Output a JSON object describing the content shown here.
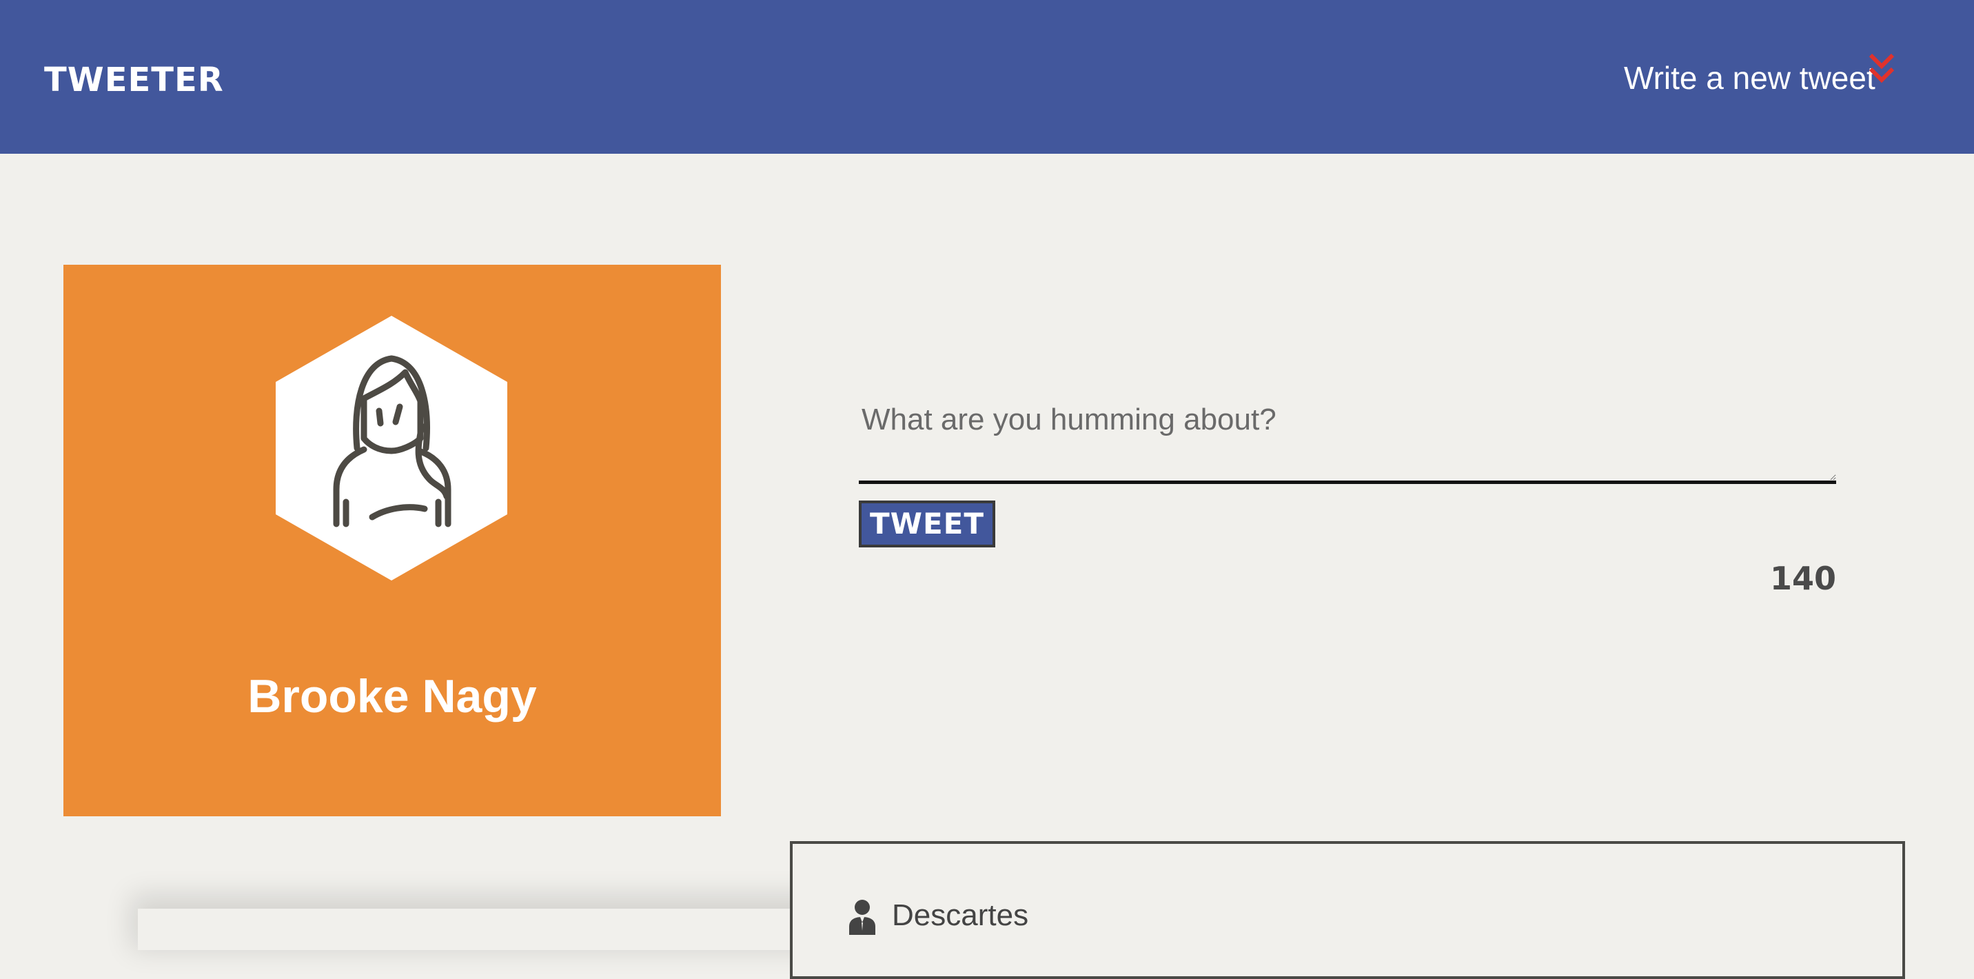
{
  "header": {
    "brand": "TWEETER",
    "compose_link": "Write a new tweet",
    "compose_icon": "double-chevron-down-icon",
    "compose_icon_color": "#e0322c",
    "background_color": "#42579c"
  },
  "profile": {
    "name": "Brooke Nagy",
    "avatar_icon": "woman-avatar-icon",
    "card_color": "#ec8c35"
  },
  "composer": {
    "placeholder": "What are you humming about?",
    "submit_label": "TWEET",
    "char_count": "140"
  },
  "tweets": [
    {
      "author": "Descartes",
      "author_icon": "user-icon"
    }
  ]
}
